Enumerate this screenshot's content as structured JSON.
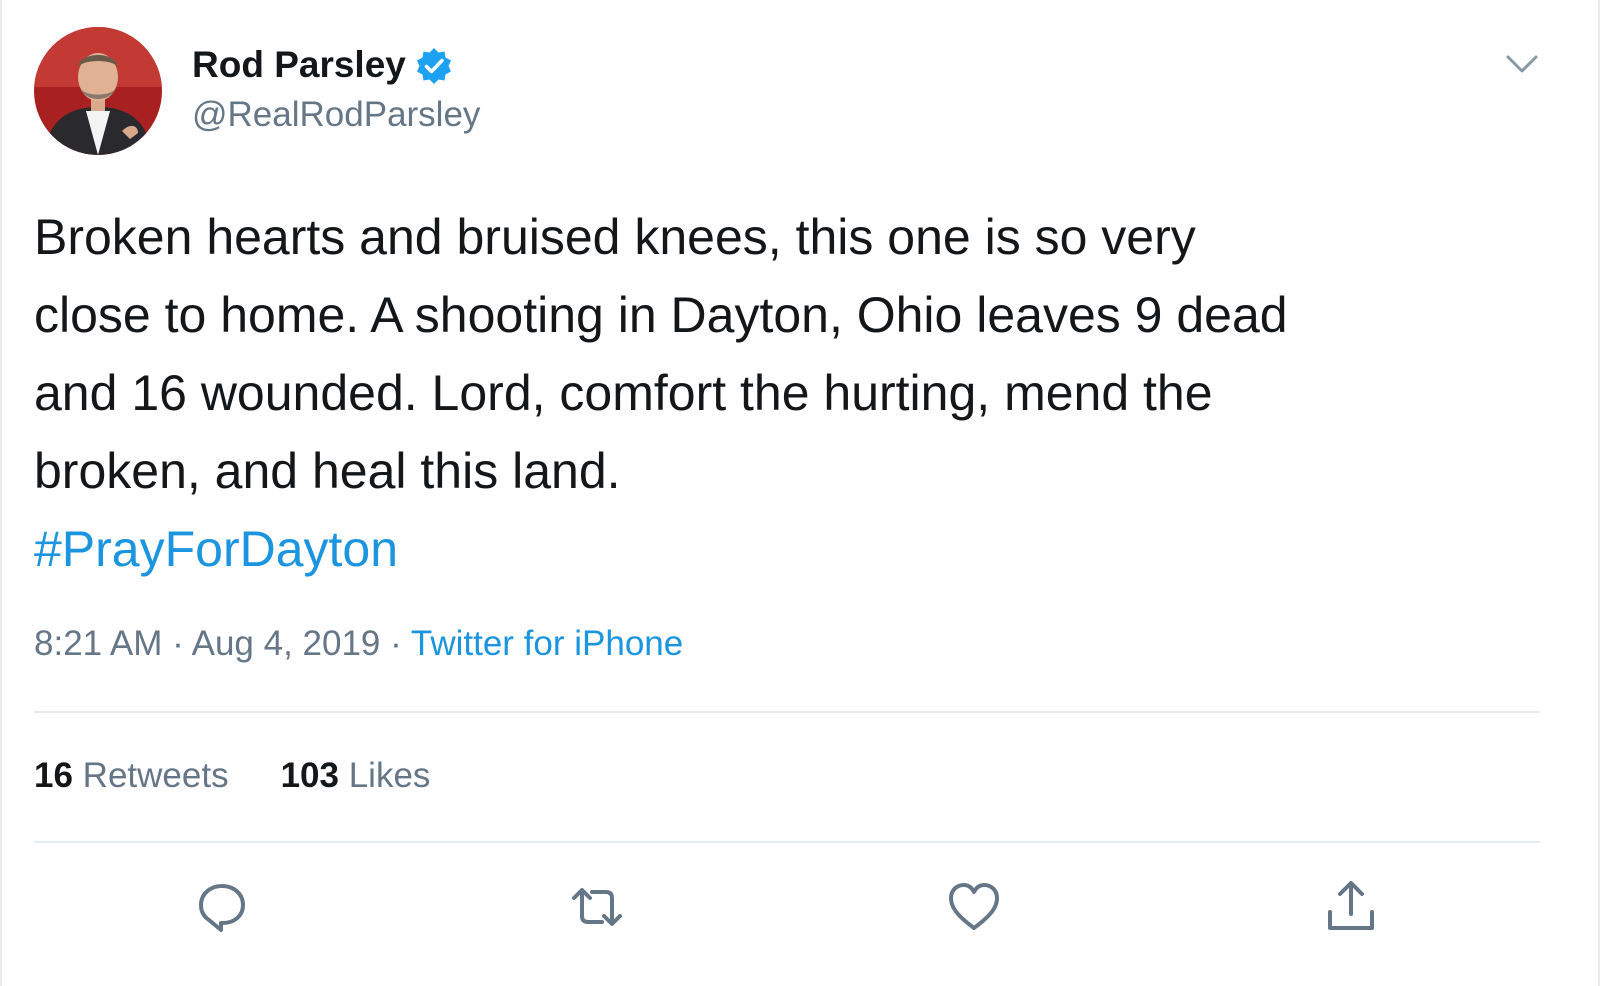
{
  "tweet": {
    "author": {
      "name": "Rod Parsley",
      "handle": "@RealRodParsley"
    },
    "text_lines": [
      "Broken hearts and bruised knees, this one is so very",
      "close to home. A shooting in Dayton, Ohio leaves 9 dead",
      "and 16 wounded. Lord, comfort the hurting, mend the",
      "broken, and heal this land."
    ],
    "hashtag": "#PrayForDayton",
    "time": "8:21 AM",
    "separator": "·",
    "date": "Aug 4, 2019",
    "source": "Twitter for iPhone",
    "stats": {
      "retweets_count": "16",
      "retweets_label": "Retweets",
      "likes_count": "103",
      "likes_label": "Likes"
    }
  },
  "icons": {
    "verified": "verified-badge-icon",
    "menu": "chevron-down-icon",
    "reply": "reply-icon",
    "retweet": "retweet-icon",
    "like": "heart-icon",
    "share": "share-icon"
  },
  "colors": {
    "link": "#1b95e0",
    "text": "#14171a",
    "muted": "#657786",
    "divider": "#e6ecf0",
    "verified": "#1da1f2"
  }
}
